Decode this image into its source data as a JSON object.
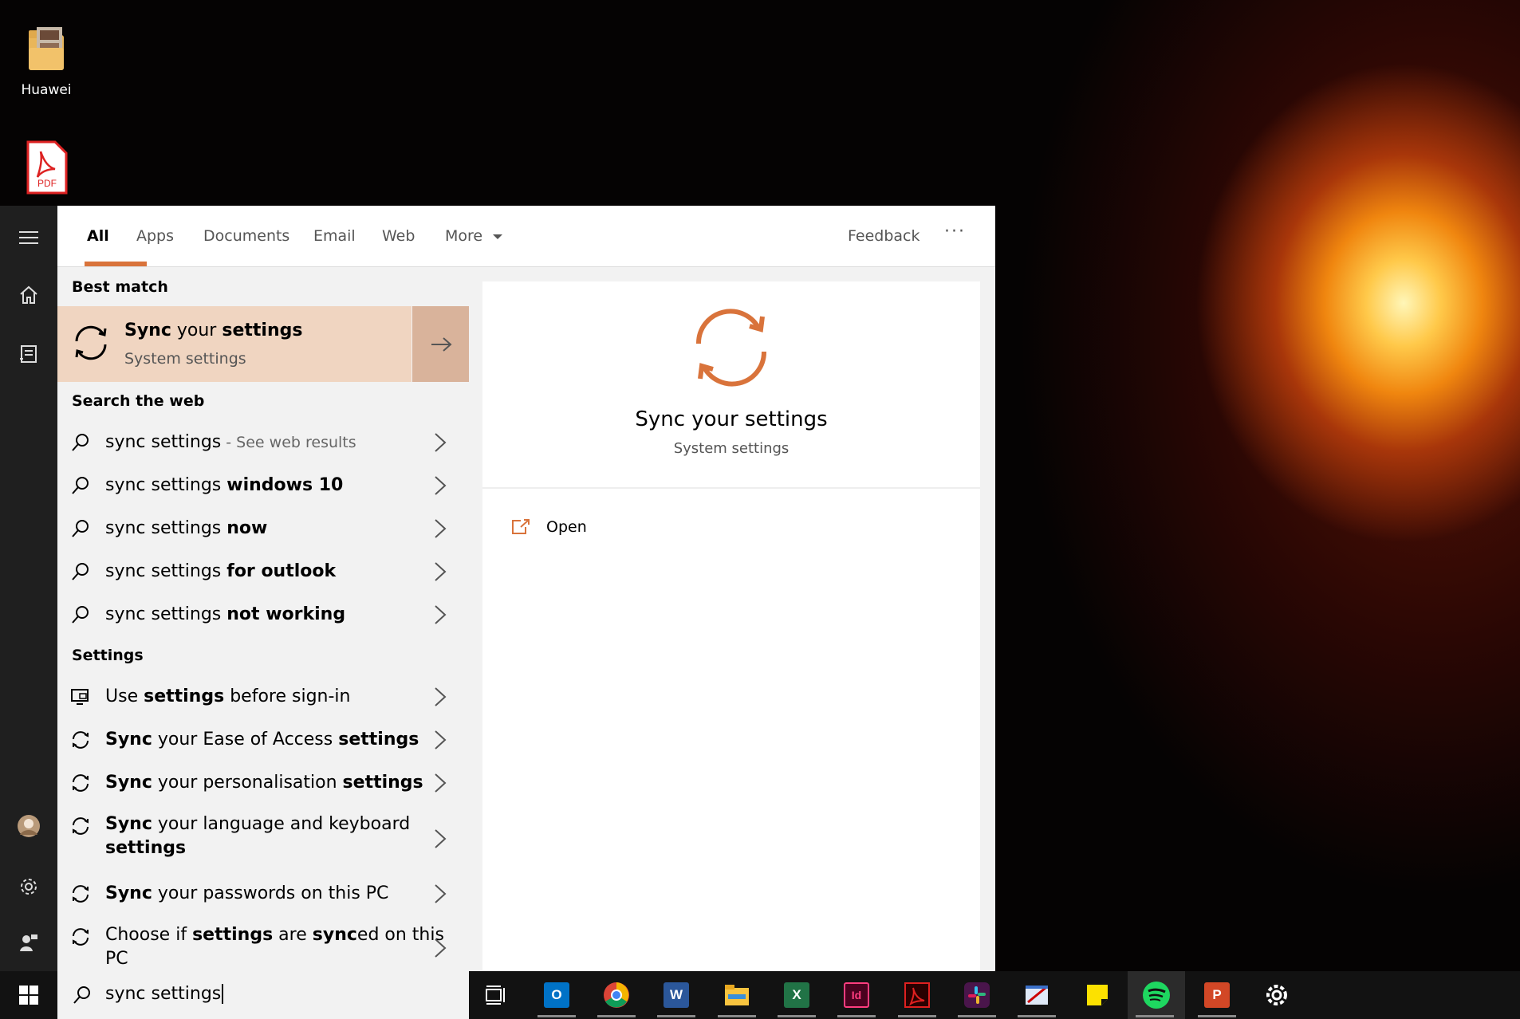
{
  "desktop": {
    "icons": [
      {
        "label": "Huawei",
        "icon": "folder-icon"
      },
      {
        "label": "",
        "icon": "pdf-file-icon",
        "badge": "PDF"
      }
    ]
  },
  "tabs": [
    {
      "label": "All",
      "active": true
    },
    {
      "label": "Apps"
    },
    {
      "label": "Documents"
    },
    {
      "label": "Email"
    },
    {
      "label": "Web"
    },
    {
      "label": "More"
    }
  ],
  "header": {
    "feedback": "Feedback",
    "more_options": "···"
  },
  "best_match": {
    "section_label": "Best match",
    "title_bold": "Sync",
    "title_mid": " your ",
    "title_bold2": "settings",
    "subtitle": "System settings"
  },
  "web": {
    "section_label": "Search the web",
    "items": [
      {
        "prefix": "sync settings",
        "bold": "",
        "suffix": " - See web results"
      },
      {
        "prefix": "sync settings ",
        "bold": "windows 10",
        "suffix": ""
      },
      {
        "prefix": "sync settings ",
        "bold": "now",
        "suffix": ""
      },
      {
        "prefix": "sync settings ",
        "bold": "for outlook",
        "suffix": ""
      },
      {
        "prefix": "sync settings ",
        "bold": "not working",
        "suffix": ""
      }
    ]
  },
  "settings": {
    "section_label": "Settings",
    "item0": {
      "a": "Use ",
      "b": "settings",
      "c": " before sign-in"
    },
    "item1": {
      "a": "Sync",
      "b": " your Ease of Access ",
      "c": "settings"
    },
    "item2": {
      "a": "Sync",
      "b": " your personalisation ",
      "c": "settings"
    },
    "item3": {
      "a": "Sync",
      "b": " your language and keyboard",
      "c": "settings"
    },
    "item4": {
      "a": "Sync",
      "b": " your passwords on this PC"
    },
    "item5": {
      "a": "Choose if ",
      "b": "settings",
      "c": " are ",
      "d": "sync",
      "e": "ed on this",
      "f": "PC"
    }
  },
  "preview": {
    "title": "Sync your settings",
    "subtitle": "System settings",
    "open_label": "Open"
  },
  "search": {
    "value": "sync settings"
  },
  "accent": "#d9733b",
  "taskbar": {
    "apps": [
      {
        "name": "task-view-icon"
      },
      {
        "name": "outlook-icon",
        "glyph": "O"
      },
      {
        "name": "chrome-icon"
      },
      {
        "name": "word-icon",
        "glyph": "W"
      },
      {
        "name": "file-explorer-icon"
      },
      {
        "name": "excel-icon",
        "glyph": "X"
      },
      {
        "name": "indesign-icon",
        "glyph": "Id"
      },
      {
        "name": "acrobat-icon"
      },
      {
        "name": "slack-icon"
      },
      {
        "name": "snipping-tool-icon"
      },
      {
        "name": "sticky-notes-icon"
      },
      {
        "name": "spotify-icon"
      },
      {
        "name": "powerpoint-icon",
        "glyph": "P"
      },
      {
        "name": "settings-icon"
      }
    ]
  }
}
